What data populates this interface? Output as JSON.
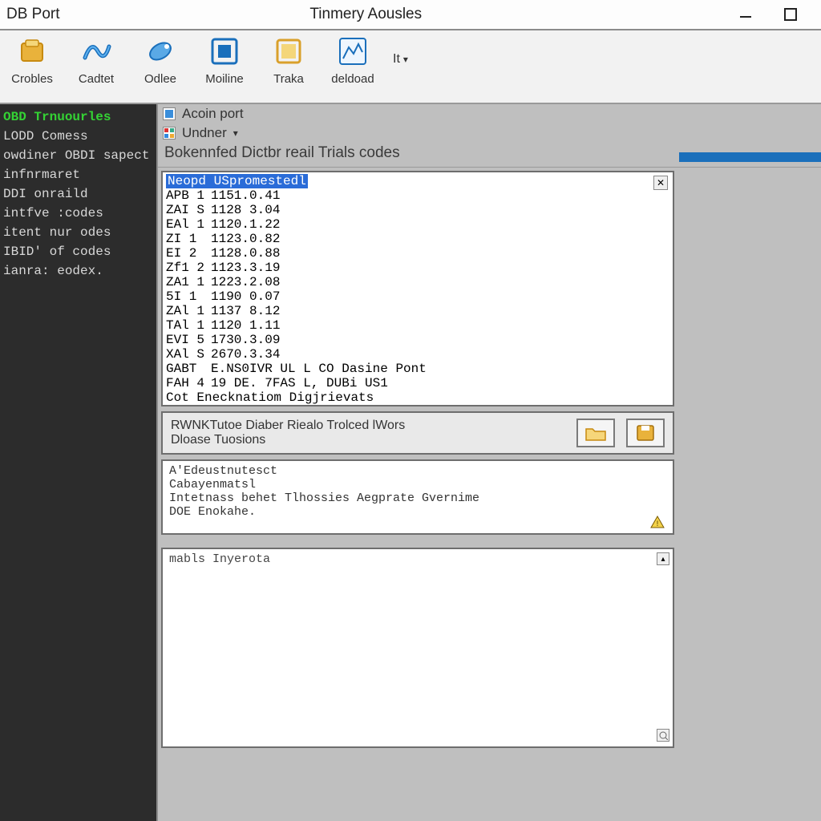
{
  "window": {
    "title_left": "DB Port",
    "title_center": "Tinmery Aousles"
  },
  "toolbar": {
    "items": [
      {
        "label": "Crobles"
      },
      {
        "label": "Cadtet"
      },
      {
        "label": "Odlee"
      },
      {
        "label": "Moiline"
      },
      {
        "label": "Traka"
      },
      {
        "label": "deldoad"
      }
    ],
    "dropdown_label": "It"
  },
  "sidebar": {
    "items": [
      {
        "label": "OBD Trnuourles",
        "active": true
      },
      {
        "label": "LODD Comess"
      },
      {
        "label": "owdiner OBDI sapect odes"
      },
      {
        "label": "infnrmaret"
      },
      {
        "label": "DDI onraild"
      },
      {
        "label": "intfve :codes"
      },
      {
        "label": "itent nur odes"
      },
      {
        "label": "IBID' of codes"
      },
      {
        "label": "ianra: eodex."
      }
    ]
  },
  "main": {
    "crumb1": "Acoin port",
    "crumb2": "Undner",
    "section_title": "Bokennfed Dictbr reail Trials codes",
    "codes": {
      "header": "Neopd USpromestedl",
      "rows": [
        {
          "c1": "APB 1",
          "c2": "1151.0.41"
        },
        {
          "c1": "ZAI S",
          "c2": "1128 3.04"
        },
        {
          "c1": "EAl 1",
          "c2": "1120.1.22"
        },
        {
          "c1": "ZI 1",
          "c2": "1123.0.82"
        },
        {
          "c1": "EI 2",
          "c2": "1128.0.88"
        },
        {
          "c1": "Zf1 2",
          "c2": "1123.3.19"
        },
        {
          "c1": "ZA1 1",
          "c2": "1223.2.08"
        },
        {
          "c1": "5I 1",
          "c2": "1190 0.07"
        },
        {
          "c1": "ZAl 1",
          "c2": "1137 8.12"
        },
        {
          "c1": "TAl 1",
          "c2": "1120 1.11"
        },
        {
          "c1": "EVI 5",
          "c2": "1730.3.09"
        },
        {
          "c1": "XAl S",
          "c2": "2670.3.34"
        }
      ],
      "tail1_a": "GABT",
      "tail1_b": "E.NS0IVR UL L CO Dasine Pont",
      "tail2_a": "FAH 4",
      "tail2_b": "19 DE. 7FAS L, DUBi US1",
      "tail3": "Cot Enecknatiom Digjrievats"
    },
    "status": {
      "line1": "RWNKTutoe Diaber Riealo Trolced lWors",
      "line2": "Dloase Tuosions"
    },
    "details": {
      "items": [
        "A'Edeustnutesct",
        "Cabayenmatsl",
        "Intetnass behet Tlhossies Aegprate Gvernime",
        "DOE Enokahe."
      ]
    },
    "notes": {
      "text": "mabls Inyerota"
    }
  }
}
